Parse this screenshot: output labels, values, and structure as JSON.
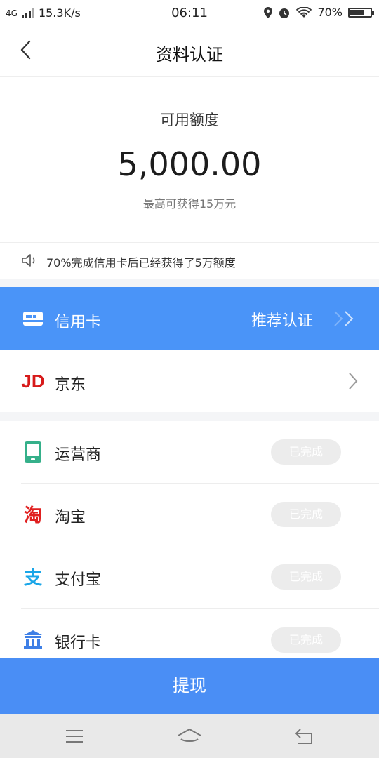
{
  "status_bar": {
    "network": "4G",
    "speed": "15.3K/s",
    "time": "06:11",
    "battery": "70%",
    "battery_level": 0.7
  },
  "header": {
    "title": "资料认证"
  },
  "credit": {
    "label": "可用额度",
    "amount": "5,000.00",
    "subtitle": "最高可获得15万元"
  },
  "notice": {
    "text": "70%完成信用卡后已经获得了5万额度"
  },
  "sections": {
    "credit_card": {
      "label": "信用卡",
      "action": "推荐认证"
    },
    "jd": {
      "label": "京东",
      "logo": "JD"
    },
    "carrier": {
      "label": "运营商",
      "status": "已完成"
    },
    "taobao": {
      "label": "淘宝",
      "logo": "淘",
      "status": "已完成"
    },
    "alipay": {
      "label": "支付宝",
      "logo": "支",
      "status": "已完成"
    },
    "bank": {
      "label": "银行卡",
      "status": "已完成"
    }
  },
  "footer": {
    "withdraw": "提现"
  },
  "colors": {
    "primary": "#4a94f8",
    "withdraw_bg": "#4a8ef5",
    "jd_red": "#d71a1a",
    "taobao_red": "#e02020",
    "alipay_blue": "#1aa6e8",
    "carrier_green": "#35b08a",
    "bank_blue": "#3e7fe6"
  }
}
